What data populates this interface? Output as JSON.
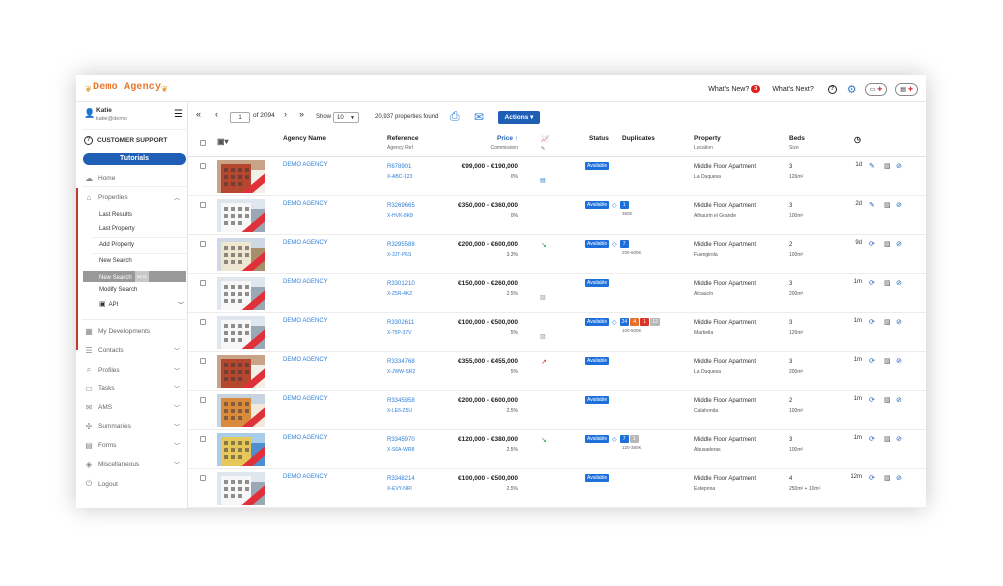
{
  "app": {
    "logo_text": "Demo Agency"
  },
  "topbar": {
    "whats_new": "What's New?",
    "whats_new_count": "3",
    "whats_next": "What's Next?",
    "help_icon": "question-circle-icon",
    "settings_icon": "gear-icon"
  },
  "sidebar": {
    "user_name": "Katie",
    "user_email": "katie@demo",
    "support_label": "CUSTOMER SUPPORT",
    "tutorials_label": "Tutorials",
    "home_label": "Home",
    "properties_label": "Properties",
    "properties_sub": [
      "Last Results",
      "Last Property",
      "Add Property",
      "New Search",
      "New Search",
      "Modify Search",
      "API"
    ],
    "beta_tag": "BETA",
    "items": [
      "My Developments",
      "Contacts",
      "Profiles",
      "Tasks",
      "AMS",
      "Summaries",
      "Forms",
      "Miscellaneous",
      "Logout"
    ]
  },
  "toolbar": {
    "page_value": "1",
    "page_of": "of 2094",
    "show_label": "Show",
    "show_value": "10",
    "found_text": "20,937 properties found",
    "actions_label": "Actions"
  },
  "table": {
    "headers": {
      "agency": "Agency Name",
      "reference": "Reference",
      "reference_sub": "Agency Ref",
      "price": "Price",
      "price_sub": "Commission",
      "status": "Status",
      "duplicates": "Duplicates",
      "property": "Property",
      "property_sub": "Location",
      "beds": "Beds",
      "beds_sub": "Size"
    },
    "rows": [
      {
        "agency": "DEMO AGENCY",
        "ref": "R678901",
        "agency_ref": "X-ABC-123",
        "price": "€99,000 - €190,000",
        "comm": "0%",
        "status": "Available",
        "dups": [],
        "dup_sub": "",
        "type": "Middle Floor Apartment",
        "loc": "La Duquesa",
        "beds": "3",
        "size": "126m²",
        "age": "1d",
        "trend": "",
        "img": "red"
      },
      {
        "agency": "DEMO AGENCY",
        "ref": "R3269665",
        "agency_ref": "X-HVK-8K8",
        "price": "€350,000 - €360,000",
        "comm": "0%",
        "status": "Available",
        "dups": [
          {
            "t": "1",
            "c": "#1e6fd9"
          }
        ],
        "dup_sub": "350K",
        "type": "Middle Floor Apartment",
        "loc": "Alhaurín el Grande",
        "beds": "3",
        "size": "100m²",
        "age": "2d",
        "trend": "",
        "img": "white"
      },
      {
        "agency": "DEMO AGENCY",
        "ref": "R3295588",
        "agency_ref": "X-3JT-P6S",
        "price": "€200,000 - €600,000",
        "comm": "3.3%",
        "status": "Available",
        "dups": [
          {
            "t": "7",
            "c": "#1e6fd9"
          }
        ],
        "dup_sub": "200-600K",
        "type": "Middle Floor Apartment",
        "loc": "Fuengirola",
        "beds": "2",
        "size": "100m²",
        "age": "9d",
        "trend": "down",
        "img": "cream"
      },
      {
        "agency": "DEMO AGENCY",
        "ref": "R3301210",
        "agency_ref": "X-Z5R-4KZ",
        "price": "€150,000 - €260,000",
        "comm": "2.5%",
        "status": "Available",
        "dups": [],
        "dup_sub": "",
        "type": "Middle Floor Apartment",
        "loc": "Alcaucín",
        "beds": "3",
        "size": "200m²",
        "age": "1m",
        "trend": "",
        "img": "white"
      },
      {
        "agency": "DEMO AGENCY",
        "ref": "R3302611",
        "agency_ref": "X-75P-37V",
        "price": "€100,000 - €500,000",
        "comm": "5%",
        "status": "Available",
        "dups": [
          {
            "t": "24",
            "c": "#1e6fd9"
          },
          {
            "t": "4",
            "c": "#e8702a"
          },
          {
            "t": "1",
            "c": "#d9342b"
          },
          {
            "t": "12",
            "c": "#b8b8b8"
          }
        ],
        "dup_sub": "100-500K",
        "type": "Middle Floor Apartment",
        "loc": "Marbella",
        "beds": "3",
        "size": "126m²",
        "age": "1m",
        "trend": "",
        "img": "white"
      },
      {
        "agency": "DEMO AGENCY",
        "ref": "R3334768",
        "agency_ref": "X-JWW-SR2",
        "price": "€355,000 - €455,000",
        "comm": "5%",
        "status": "Available",
        "dups": [],
        "dup_sub": "",
        "type": "Middle Floor Apartment",
        "loc": "La Duquesa",
        "beds": "3",
        "size": "200m²",
        "age": "1m",
        "trend": "up",
        "img": "red"
      },
      {
        "agency": "DEMO AGENCY",
        "ref": "R3345958",
        "agency_ref": "X-LE6-Z5U",
        "price": "€200,000 - €600,000",
        "comm": "2.5%",
        "status": "Available",
        "dups": [],
        "dup_sub": "",
        "type": "Middle Floor Apartment",
        "loc": "Calahonda",
        "beds": "2",
        "size": "100m²",
        "age": "1m",
        "trend": "",
        "img": "orange"
      },
      {
        "agency": "DEMO AGENCY",
        "ref": "R3345970",
        "agency_ref": "X-S6A-WR8",
        "price": "€120,000 - €380,000",
        "comm": "2.5%",
        "status": "Available",
        "dups": [
          {
            "t": "7",
            "c": "#1e6fd9"
          },
          {
            "t": "1",
            "c": "#b8b8b8"
          }
        ],
        "dup_sub": "120-380K",
        "type": "Middle Floor Apartment",
        "loc": "Abusaderas",
        "beds": "3",
        "size": "100m²",
        "age": "1m",
        "trend": "down",
        "img": "color"
      },
      {
        "agency": "DEMO AGENCY",
        "ref": "R3348214",
        "agency_ref": "X-EVY-NRI",
        "price": "€100,000 - €500,000",
        "comm": "2.5%",
        "status": "Available",
        "dups": [],
        "dup_sub": "",
        "type": "Middle Floor Apartment",
        "loc": "Estepona",
        "beds": "4",
        "size": "250m² + 10m²",
        "age": "12m",
        "trend": "",
        "img": "white"
      }
    ]
  }
}
